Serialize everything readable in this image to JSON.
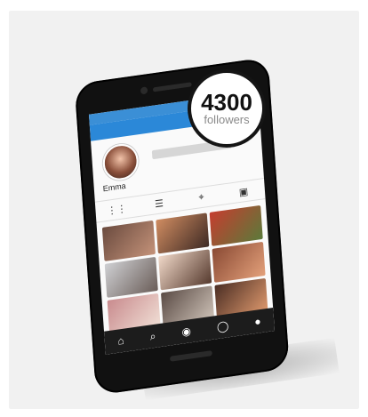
{
  "profile": {
    "username": "Emma",
    "followers_count": "4300",
    "followers_label": "followers"
  },
  "tabs": [
    {
      "name": "grid-icon",
      "glyph": "⋮⋮"
    },
    {
      "name": "list-icon",
      "glyph": "☰"
    },
    {
      "name": "location-icon",
      "glyph": "⌖"
    },
    {
      "name": "tagged-icon",
      "glyph": "▣"
    }
  ],
  "bottom_nav": [
    {
      "name": "home-icon",
      "glyph": "⌂"
    },
    {
      "name": "search-icon",
      "glyph": "⌕"
    },
    {
      "name": "camera-icon",
      "glyph": "◉"
    },
    {
      "name": "activity-icon",
      "glyph": "◯"
    },
    {
      "name": "profile-icon",
      "glyph": "●"
    }
  ],
  "colors": {
    "accent": "#2b88d8",
    "badge_border": "#151515",
    "phone_body": "#111111"
  }
}
